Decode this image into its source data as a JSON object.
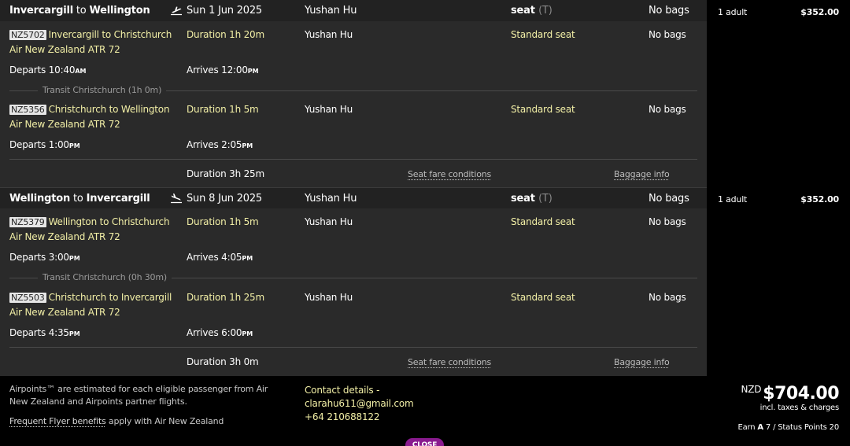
{
  "trips": [
    {
      "header": {
        "origin": "Invercargill",
        "to_word": "to",
        "destination": "Wellington",
        "icon": "plane-departure-icon",
        "date": "Sun 1 Jun 2025",
        "passenger": "Yushan Hu",
        "seat_label": "seat",
        "seat_code": "(T)",
        "bags": "No bags"
      },
      "segments": [
        {
          "flight_code": "NZ5702",
          "route": "Invercargill to Christchurch",
          "aircraft": "Air New Zealand ATR 72",
          "duration": "Duration 1h 20m",
          "passenger": "Yushan Hu",
          "seat": "Standard seat",
          "bags": "No bags",
          "departs_label": "Departs",
          "departs_time": "10:40",
          "departs_ampm": "AM",
          "arrives_label": "Arrives",
          "arrives_time": "12:00",
          "arrives_ampm": "PM"
        },
        {
          "flight_code": "NZ5356",
          "route": "Christchurch to Wellington",
          "aircraft": "Air New Zealand ATR 72",
          "duration": "Duration 1h 5m",
          "passenger": "Yushan Hu",
          "seat": "Standard seat",
          "bags": "No bags",
          "departs_label": "Departs",
          "departs_time": "1:00",
          "departs_ampm": "PM",
          "arrives_label": "Arrives",
          "arrives_time": "2:05",
          "arrives_ampm": "PM"
        }
      ],
      "transit": "Transit Christchurch (1h 0m)",
      "total_duration": "Duration 3h 25m",
      "seat_conditions": "Seat fare conditions",
      "baggage_info": "Baggage info",
      "side": {
        "passengers": "1 adult",
        "price": "$352.00"
      }
    },
    {
      "header": {
        "origin": "Wellington",
        "to_word": "to",
        "destination": "Invercargill",
        "icon": "plane-arrival-icon",
        "date": "Sun 8 Jun 2025",
        "passenger": "Yushan Hu",
        "seat_label": "seat",
        "seat_code": "(T)",
        "bags": "No bags"
      },
      "segments": [
        {
          "flight_code": "NZ5379",
          "route": "Wellington to Christchurch",
          "aircraft": "Air New Zealand ATR 72",
          "duration": "Duration 1h 5m",
          "passenger": "Yushan Hu",
          "seat": "Standard seat",
          "bags": "No bags",
          "departs_label": "Departs",
          "departs_time": "3:00",
          "departs_ampm": "PM",
          "arrives_label": "Arrives",
          "arrives_time": "4:05",
          "arrives_ampm": "PM"
        },
        {
          "flight_code": "NZ5503",
          "route": "Christchurch to Invercargill",
          "aircraft": "Air New Zealand ATR 72",
          "duration": "Duration 1h 25m",
          "passenger": "Yushan Hu",
          "seat": "Standard seat",
          "bags": "No bags",
          "departs_label": "Departs",
          "departs_time": "4:35",
          "departs_ampm": "PM",
          "arrives_label": "Arrives",
          "arrives_time": "6:00",
          "arrives_ampm": "PM"
        }
      ],
      "transit": "Transit Christchurch (0h 30m)",
      "total_duration": "Duration 3h 0m",
      "seat_conditions": "Seat fare conditions",
      "baggage_info": "Baggage info",
      "side": {
        "passengers": "1 adult",
        "price": "$352.00"
      }
    }
  ],
  "footer": {
    "airpoints_note": "Airpoints™ are estimated for each eligible passenger from Air New Zealand and Airpoints partner flights.",
    "frequent_flyer_link": "Frequent Flyer benefits",
    "frequent_flyer_suffix": "apply with Air New Zealand",
    "contact_label": "Contact details -",
    "contact_email": "clarahu611@gmail.com",
    "contact_phone": "+64 210688122",
    "currency": "NZD",
    "total": "$704.00",
    "total_note": "incl. taxes & charges",
    "earn_prefix": "Earn",
    "earn_icon": "airpoints-icon",
    "earn_suffix": "7 / Status Points 20",
    "close_label": "CLOSE"
  }
}
